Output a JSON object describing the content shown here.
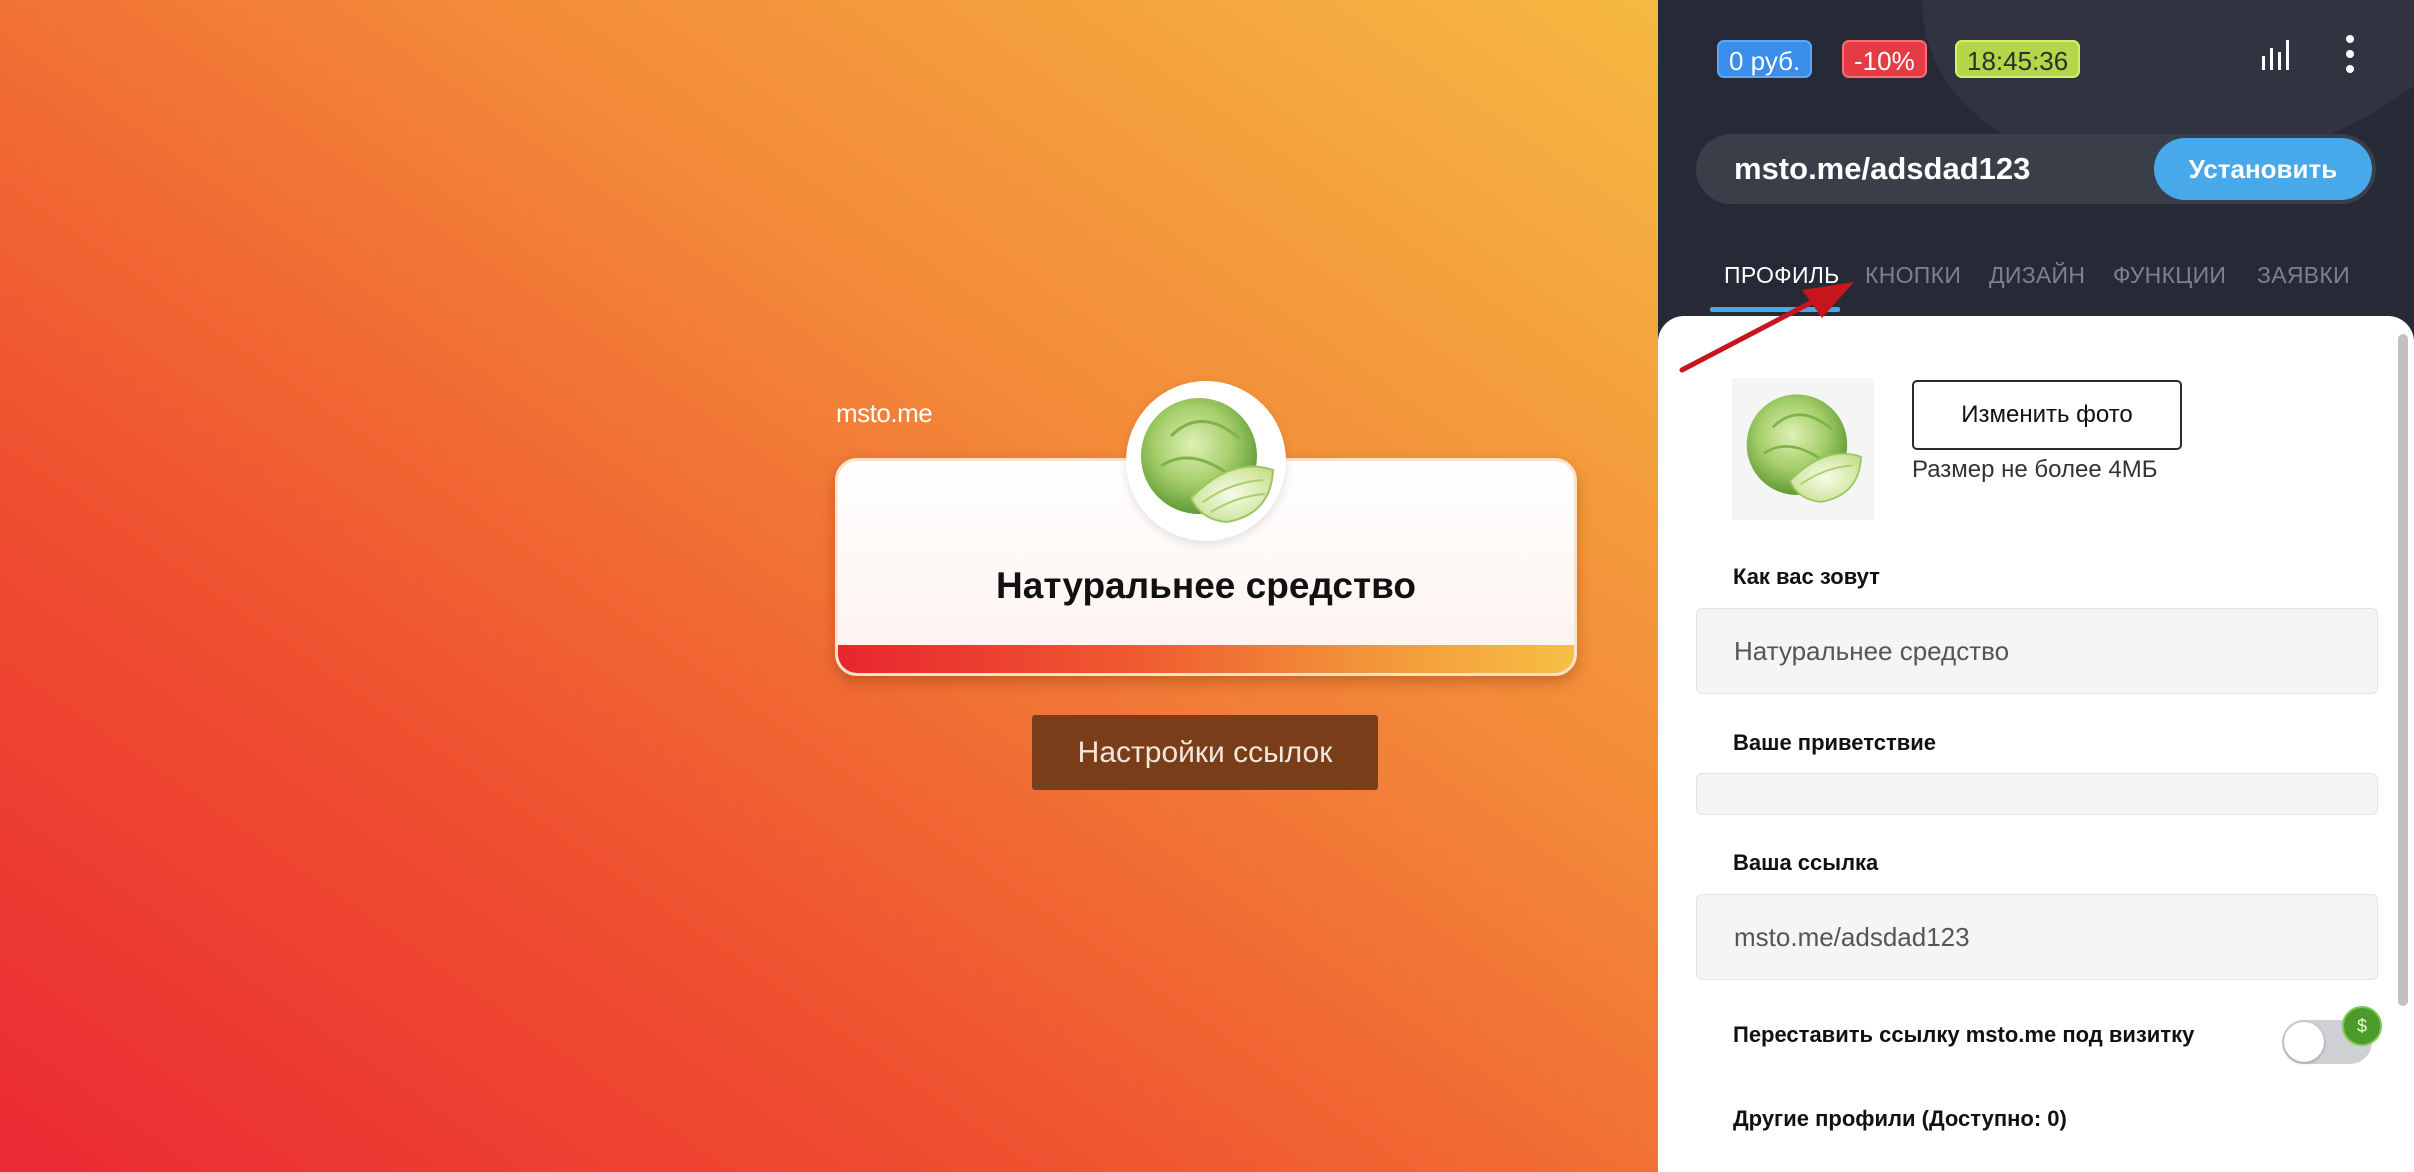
{
  "preview": {
    "site_label": "msto.me",
    "card_title": "Натуральнее средство",
    "settings_button": "Настройки ссылок"
  },
  "panel": {
    "badges": {
      "balance": "0 руб.",
      "discount": "-10%",
      "timer": "18:45:36"
    },
    "url": "msto.me/adsdad123",
    "install_button": "Установить",
    "tabs": [
      {
        "label": "ПРОФИЛЬ",
        "active": true
      },
      {
        "label": "КНОПКИ",
        "active": false
      },
      {
        "label": "ДИЗАЙН",
        "active": false
      },
      {
        "label": "ФУНКЦИИ",
        "active": false
      },
      {
        "label": "ЗАЯВКИ",
        "active": false
      }
    ],
    "profile": {
      "change_photo_button": "Изменить фото",
      "photo_hint": "Размер не более 4МБ",
      "name_label": "Как вас зовут",
      "name_value": "Натуральнее средство",
      "greeting_label": "Ваше приветствие",
      "greeting_value": "",
      "link_label": "Ваша ссылка",
      "link_value": "msto.me/adsdad123",
      "move_link_label": "Переставить ссылку msto.me под визитку",
      "move_link_enabled": false,
      "paid_badge": "$",
      "other_profiles_label": "Другие профили (Доступно: 0)"
    }
  },
  "colors": {
    "panel_bg": "#262a36",
    "accent": "#47a9ea",
    "badge_blue": "#3a8de8",
    "badge_red": "#e43b45",
    "badge_green": "#b4d64a",
    "settings_button": "#7a3d1a",
    "annotation_arrow": "#c6151d"
  },
  "icons": {
    "stats": "bar-chart-icon",
    "menu": "kebab-menu-icon",
    "avatar": "cabbage-image"
  }
}
